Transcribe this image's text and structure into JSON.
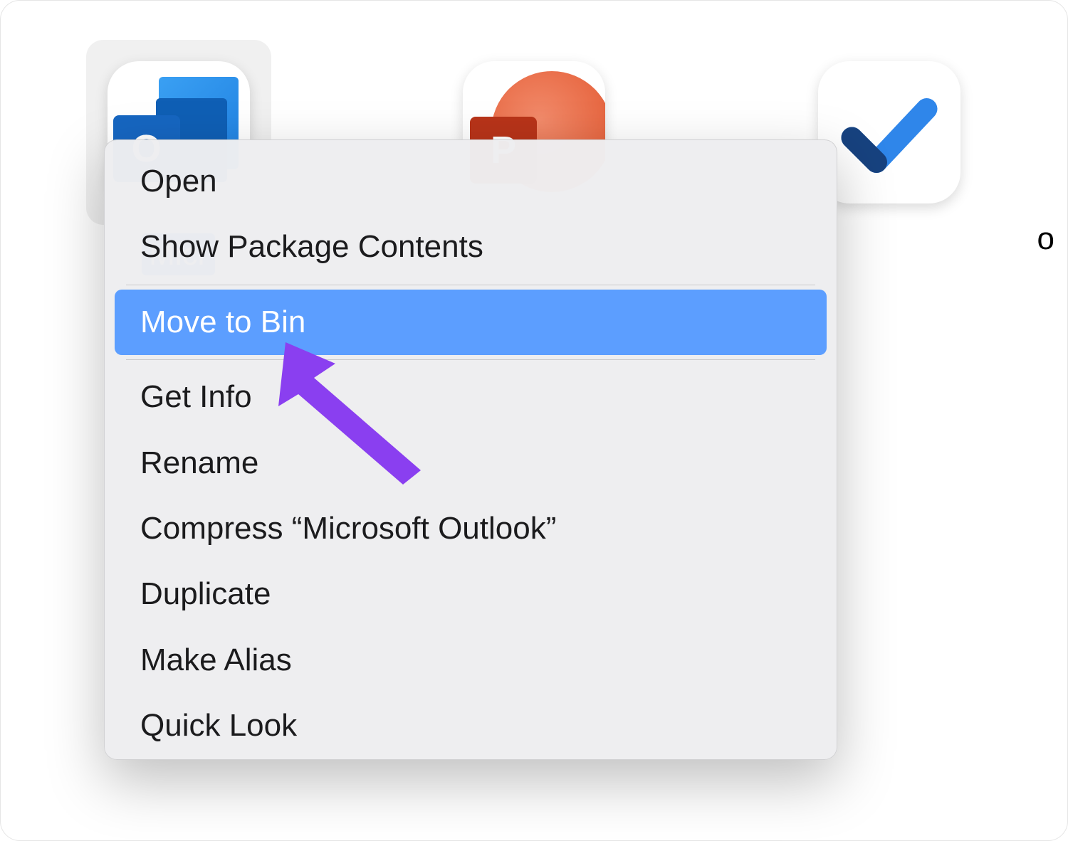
{
  "apps": [
    {
      "name": "outlook",
      "label_visible": "Micr",
      "letter": "O",
      "selected": true
    },
    {
      "name": "powerpoint",
      "label_visible": "",
      "letter": "P",
      "selected": false
    },
    {
      "name": "todo",
      "label_visible": "",
      "letter": "",
      "selected": false
    }
  ],
  "stray_text": "o",
  "context_menu": {
    "group1": [
      "Open",
      "Show Package Contents"
    ],
    "highlighted": "Move to Bin",
    "group2": [
      "Get Info",
      "Rename",
      "Compress “Microsoft Outlook”",
      "Duplicate",
      "Make Alias",
      "Quick Look"
    ]
  },
  "annotation": {
    "arrow_color": "#8a3ff0"
  }
}
